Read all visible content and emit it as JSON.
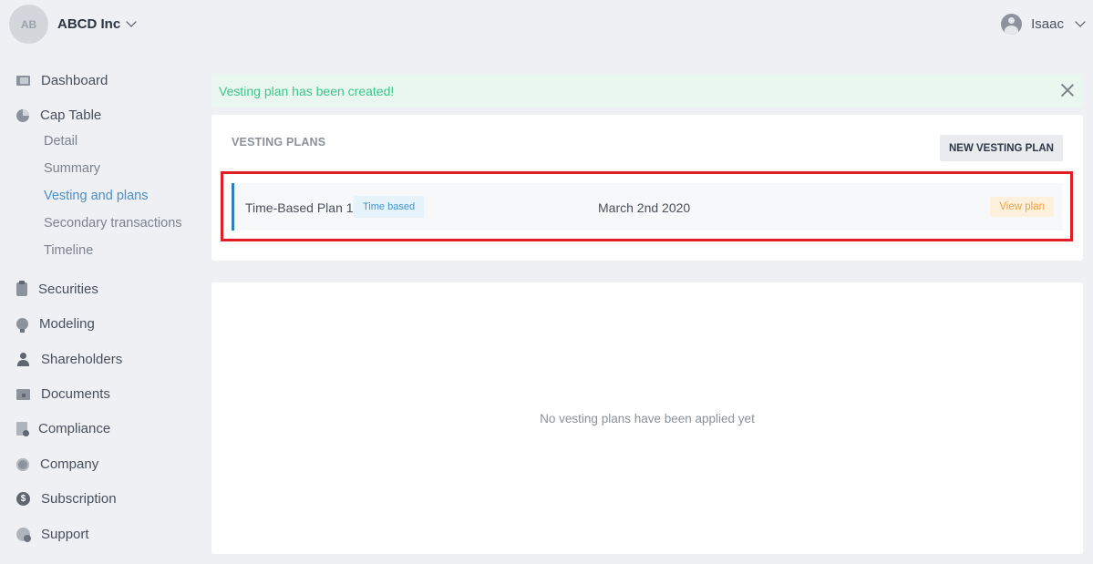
{
  "header": {
    "org_initials": "AB",
    "org_name": "ABCD Inc",
    "user_name": "Isaac"
  },
  "sidebar": {
    "items": [
      {
        "label": "Dashboard",
        "icon": "dashboard-icon"
      },
      {
        "label": "Cap Table",
        "icon": "pie-chart-icon"
      },
      {
        "label": "Securities",
        "icon": "clipboard-icon"
      },
      {
        "label": "Modeling",
        "icon": "lightbulb-icon"
      },
      {
        "label": "Shareholders",
        "icon": "person-icon"
      },
      {
        "label": "Documents",
        "icon": "folder-icon"
      },
      {
        "label": "Compliance",
        "icon": "document-check-icon"
      },
      {
        "label": "Company",
        "icon": "gear-icon"
      },
      {
        "label": "Subscription",
        "icon": "dollar-icon"
      },
      {
        "label": "Support",
        "icon": "help-icon"
      }
    ],
    "cap_table_sub": [
      {
        "label": "Detail"
      },
      {
        "label": "Summary"
      },
      {
        "label": "Vesting and plans",
        "active": true
      },
      {
        "label": "Secondary transactions"
      },
      {
        "label": "Timeline"
      }
    ]
  },
  "alert": {
    "message": "Vesting plan has been created!"
  },
  "plans": {
    "title": "VESTING PLANS",
    "new_button": "NEW VESTING PLAN",
    "rows": [
      {
        "name": "Time-Based Plan 1",
        "badge": "Time based",
        "date": "March 2nd 2020",
        "action": "View plan"
      }
    ]
  },
  "empty_state": {
    "message": "No vesting plans have been applied yet"
  },
  "colors": {
    "accent_blue": "#2f7fc0",
    "active_link": "#4a8fc7",
    "success_text": "#3cc58a",
    "highlight_red": "#e01e25",
    "view_plan_orange": "#f0a040"
  }
}
